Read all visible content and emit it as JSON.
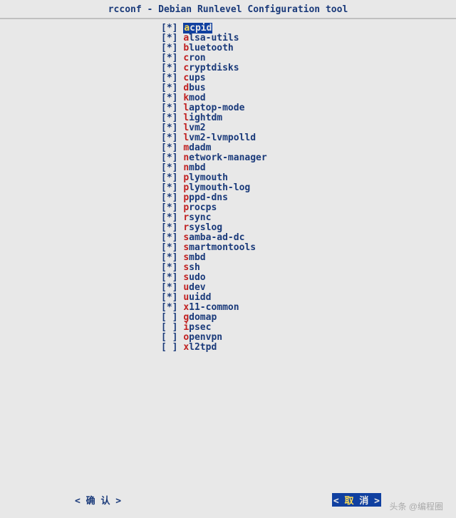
{
  "title": "rcconf - Debian Runlevel Configuration tool",
  "services": [
    {
      "checked": true,
      "name": "acpid",
      "selected": true
    },
    {
      "checked": true,
      "name": "alsa-utils",
      "selected": false
    },
    {
      "checked": true,
      "name": "bluetooth",
      "selected": false
    },
    {
      "checked": true,
      "name": "cron",
      "selected": false
    },
    {
      "checked": true,
      "name": "cryptdisks",
      "selected": false
    },
    {
      "checked": true,
      "name": "cups",
      "selected": false
    },
    {
      "checked": true,
      "name": "dbus",
      "selected": false
    },
    {
      "checked": true,
      "name": "kmod",
      "selected": false
    },
    {
      "checked": true,
      "name": "laptop-mode",
      "selected": false
    },
    {
      "checked": true,
      "name": "lightdm",
      "selected": false
    },
    {
      "checked": true,
      "name": "lvm2",
      "selected": false
    },
    {
      "checked": true,
      "name": "lvm2-lvmpolld",
      "selected": false
    },
    {
      "checked": true,
      "name": "mdadm",
      "selected": false
    },
    {
      "checked": true,
      "name": "network-manager",
      "selected": false
    },
    {
      "checked": true,
      "name": "nmbd",
      "selected": false
    },
    {
      "checked": true,
      "name": "plymouth",
      "selected": false
    },
    {
      "checked": true,
      "name": "plymouth-log",
      "selected": false
    },
    {
      "checked": true,
      "name": "pppd-dns",
      "selected": false
    },
    {
      "checked": true,
      "name": "procps",
      "selected": false
    },
    {
      "checked": true,
      "name": "rsync",
      "selected": false
    },
    {
      "checked": true,
      "name": "rsyslog",
      "selected": false
    },
    {
      "checked": true,
      "name": "samba-ad-dc",
      "selected": false
    },
    {
      "checked": true,
      "name": "smartmontools",
      "selected": false
    },
    {
      "checked": true,
      "name": "smbd",
      "selected": false
    },
    {
      "checked": true,
      "name": "ssh",
      "selected": false
    },
    {
      "checked": true,
      "name": "sudo",
      "selected": false
    },
    {
      "checked": true,
      "name": "udev",
      "selected": false
    },
    {
      "checked": true,
      "name": "uuidd",
      "selected": false
    },
    {
      "checked": true,
      "name": "x11-common",
      "selected": false
    },
    {
      "checked": false,
      "name": "gdomap",
      "selected": false
    },
    {
      "checked": false,
      "name": "ipsec",
      "selected": false
    },
    {
      "checked": false,
      "name": "openvpn",
      "selected": false
    },
    {
      "checked": false,
      "name": "xl2tpd",
      "selected": false
    }
  ],
  "buttons": {
    "ok": {
      "left": "< ",
      "hot": "确",
      "rest": " 认 >",
      "full": "< 确 认 >"
    },
    "cancel": {
      "left": "< ",
      "hot": "取",
      "rest": " 消 >",
      "full": "< 取 消 >"
    }
  },
  "watermark": "头条 @编程圈"
}
